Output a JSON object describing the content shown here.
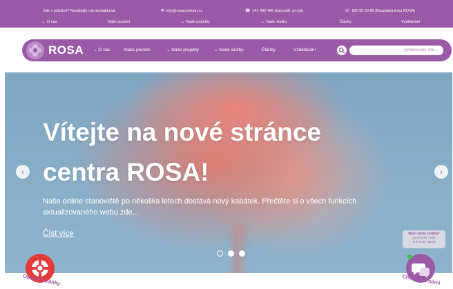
{
  "topbar": {
    "intro": "Jste v potížích? Neváhejte nás kontaktovat.",
    "email": "info@rosacentrum.cz",
    "phone": "241 432 466 (kancelář, po-pá)",
    "hotline": "800 60 50 80 (Bezplatná linka ROSA)",
    "menu": [
      "O nás",
      "Naše poslání",
      "Naše projekty",
      "Naše služby",
      "Články",
      "Vzdělávání"
    ],
    "icons": {
      "email": "mail-icon",
      "phone": "phone-icon",
      "hotline": "headset-icon",
      "chevron": "chevron-down-icon"
    }
  },
  "nav": {
    "logo": "ROSA",
    "items": [
      "O nás",
      "Naše poslání",
      "Naše projekty",
      "Naše služby",
      "Články",
      "Vzdělávání"
    ],
    "search_placeholder": "vyhledávejte zde...",
    "colors": {
      "primary": "#9b5aa8",
      "logo_badge": "#b98ac4"
    }
  },
  "hero": {
    "title_line1": "Vítejte na nové stránce",
    "title_line2": "centra ROSA!",
    "text": "Naše online stanoviště po několika letech dostává nový kabátek. Přečtěte si o všech funkcích aktualizovaného webu zde...",
    "link": "Číst více",
    "slides_total": 3
  },
  "floating": {
    "leave_label": "Opustit stránky",
    "chat_label": "Chatujte s námi",
    "chat_status": "Nyní jsme online!",
    "chat_hours_1": "po-út 8:30 - 8:30",
    "chat_hours_2": "st-fr 9:30 - 15:00",
    "colors": {
      "leave": "#e43a3a",
      "chat": "#9b5aa8",
      "online": "#3cc44a"
    }
  }
}
